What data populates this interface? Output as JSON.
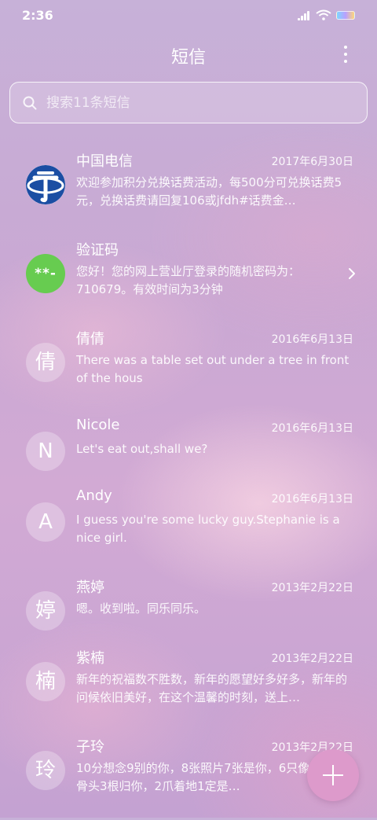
{
  "status_bar": {
    "time": "2:36"
  },
  "header": {
    "title": "短信"
  },
  "search": {
    "placeholder": "搜索11条短信"
  },
  "threads": [
    {
      "name": "中国电信",
      "date": "2017年6月30日",
      "preview": "欢迎参加积分兑换话费活动，每500分可兑换话费5元，兑换话费请回复106或jfdh#话费金…",
      "avatar_type": "logo",
      "avatar_icon": "china-telecom-logo-icon"
    },
    {
      "name": "验证码",
      "date": "",
      "preview": "您好！您的网上营业厅登录的随机密码为：710679。有效时间为3分钟",
      "avatar_type": "code",
      "avatar_text": "**-"
    },
    {
      "name": "倩倩",
      "date": "2016年6月13日",
      "preview": "There was a table set out under a tree in front of the hous",
      "avatar_text": "倩"
    },
    {
      "name": "Nicole",
      "date": "2016年6月13日",
      "preview": "Let's eat out,shall we?",
      "avatar_text": "N"
    },
    {
      "name": "Andy",
      "date": "2016年6月13日",
      "preview": "I guess you're some lucky guy.Stephanie is a nice girl.",
      "avatar_text": "A"
    },
    {
      "name": "燕婷",
      "date": "2013年2月22日",
      "preview": "嗯。收到啦。同乐同乐。",
      "avatar_text": "婷"
    },
    {
      "name": "紫楠",
      "date": "2013年2月22日",
      "preview": "新年的祝福数不胜数，新年的愿望好多好多，新年的问候依旧美好，在这个温馨的时刻，送上…",
      "avatar_text": "楠"
    },
    {
      "name": "子玲",
      "date": "2013年2月22日",
      "preview": "10分想念9别的你，8张照片7张是你，6只像你，4根骨头3根归你，2爪着地1定是…",
      "avatar_text": "玲"
    }
  ],
  "colors": {
    "fab": "#dd9acb",
    "code_avatar": "#67cc50",
    "telecom_blue": "#1b4ea3"
  }
}
